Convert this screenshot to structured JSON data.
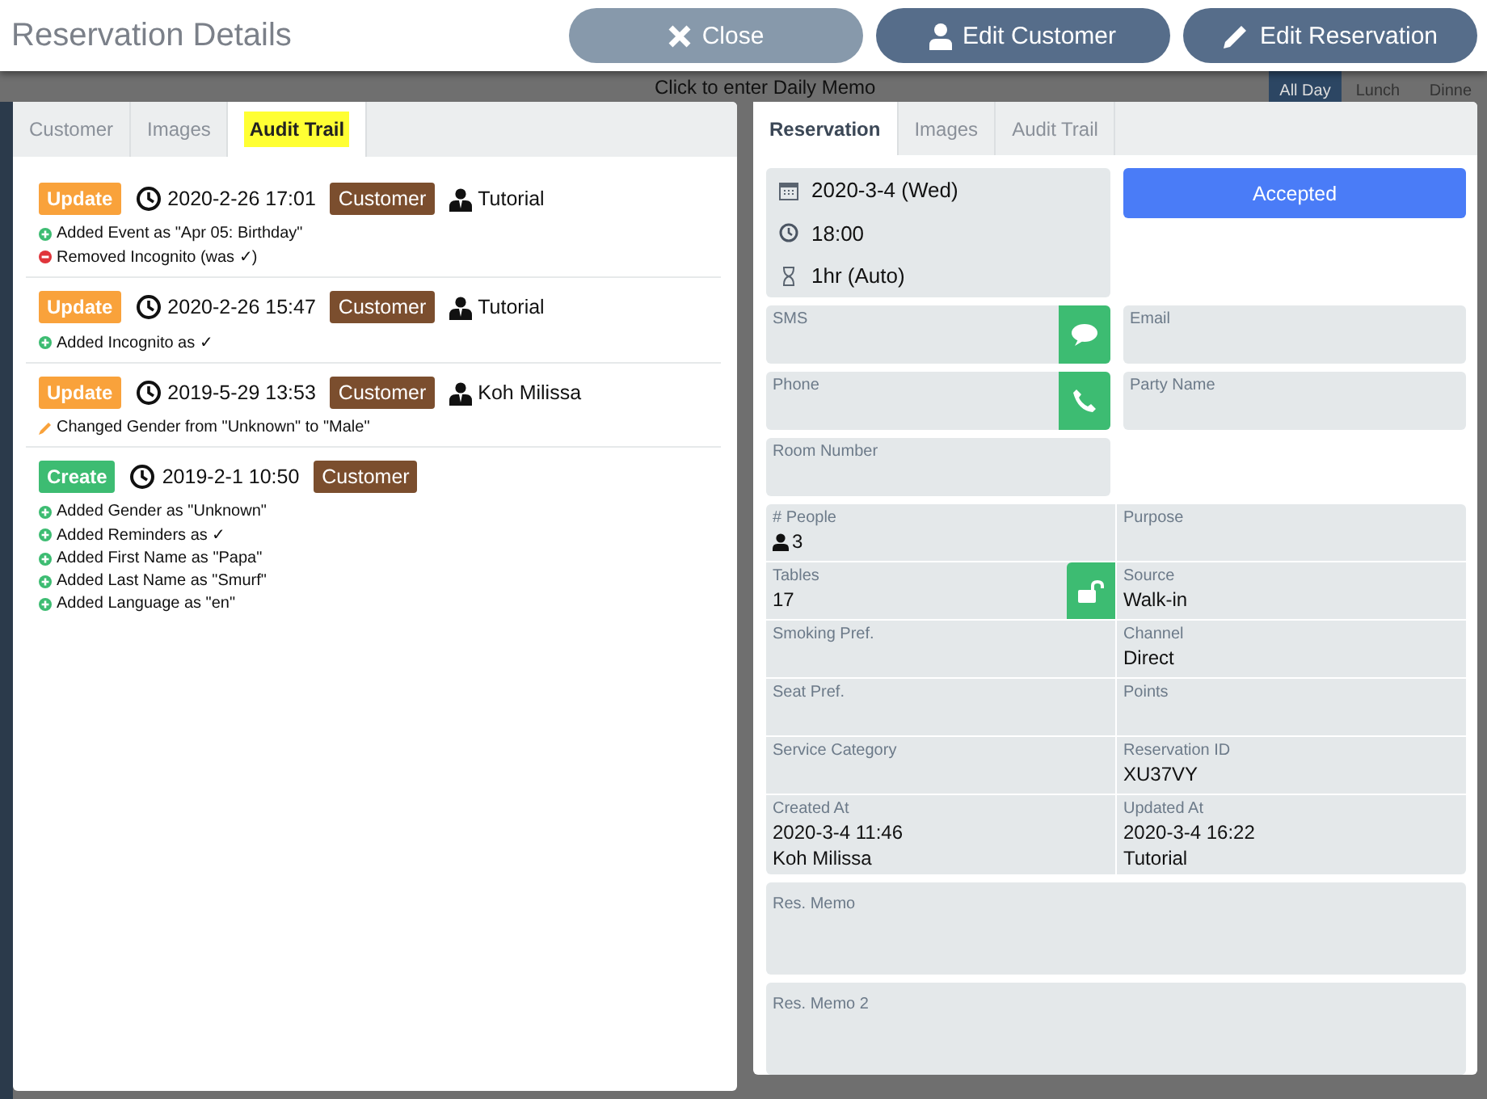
{
  "header": {
    "title": "Reservation Details",
    "buttons": [
      {
        "label": "Close",
        "kind": "close"
      },
      {
        "label": "Edit Customer",
        "kind": "customer"
      },
      {
        "label": "Edit Reservation",
        "kind": "edit"
      }
    ]
  },
  "backdrop": {
    "memo": "Click to enter Daily Memo",
    "meals": [
      {
        "label": "All Day",
        "selected": true
      },
      {
        "label": "Lunch",
        "selected": false
      },
      {
        "label": "Dinne",
        "selected": false
      }
    ]
  },
  "left_panel": {
    "tabs": [
      {
        "label": "Customer",
        "selected": false
      },
      {
        "label": "Images",
        "selected": false
      },
      {
        "label": "Audit Trail",
        "selected": true
      }
    ],
    "entries": [
      {
        "action": "Update",
        "kind": "update",
        "time": "2020-2-26 17:01",
        "target": "Customer",
        "user": "Tutorial",
        "changes": [
          {
            "kind": "added",
            "text": "Added Event as \"Apr 05: Birthday\""
          },
          {
            "kind": "removed",
            "text": "Removed Incognito (was ✓)"
          }
        ]
      },
      {
        "action": "Update",
        "kind": "update",
        "time": "2020-2-26 15:47",
        "target": "Customer",
        "user": "Tutorial",
        "changes": [
          {
            "kind": "added",
            "text": "Added Incognito as ✓"
          }
        ]
      },
      {
        "action": "Update",
        "kind": "update",
        "time": "2019-5-29 13:53",
        "target": "Customer",
        "user": "Koh Milissa",
        "changes": [
          {
            "kind": "changed",
            "text": "Changed Gender from \"Unknown\" to \"Male\""
          }
        ]
      },
      {
        "action": "Create",
        "kind": "create",
        "time": "2019-2-1 10:50",
        "target": "Customer",
        "changes": [
          {
            "kind": "added",
            "text": "Added Gender as \"Unknown\""
          },
          {
            "kind": "added",
            "text": "Added Reminders as ✓"
          },
          {
            "kind": "added",
            "text": "Added First Name as \"Papa\""
          },
          {
            "kind": "added",
            "text": "Added Last Name as \"Smurf\""
          },
          {
            "kind": "added",
            "text": "Added Language as \"en\""
          }
        ]
      }
    ]
  },
  "right_panel": {
    "tabs": [
      {
        "label": "Reservation",
        "selected": true
      },
      {
        "label": "Images",
        "selected": false
      },
      {
        "label": "Audit Trail",
        "selected": false
      }
    ],
    "date": "2020-3-4 (Wed)",
    "time": "18:00",
    "duration": "1hr (Auto)",
    "status": "Accepted",
    "contact_fields": [
      {
        "label": "SMS",
        "kind": "sms"
      },
      {
        "label": "Email"
      },
      {
        "label": "Phone",
        "kind": "phone"
      },
      {
        "label": "Party Name"
      },
      {
        "label": "Room Number"
      }
    ],
    "details": [
      {
        "label": "# People",
        "value": "3",
        "kind": "people"
      },
      {
        "label": "Purpose"
      },
      {
        "label": "Tables",
        "value": "17",
        "kind": "lock"
      },
      {
        "label": "Source",
        "value": "Walk-in"
      },
      {
        "label": "Smoking Pref."
      },
      {
        "label": "Channel",
        "value": "Direct"
      },
      {
        "label": "Seat Pref."
      },
      {
        "label": "Points"
      },
      {
        "label": "Service Category"
      },
      {
        "label": "Reservation ID",
        "value": "XU37VY"
      },
      {
        "label": "Created At",
        "value": "2020-3-4 11:46",
        "value2": "Koh Milissa"
      },
      {
        "label": "Updated At",
        "value": "2020-3-4 16:22",
        "value2": "Tutorial"
      }
    ],
    "memos": [
      "Res. Memo",
      "Res. Memo 2"
    ]
  }
}
